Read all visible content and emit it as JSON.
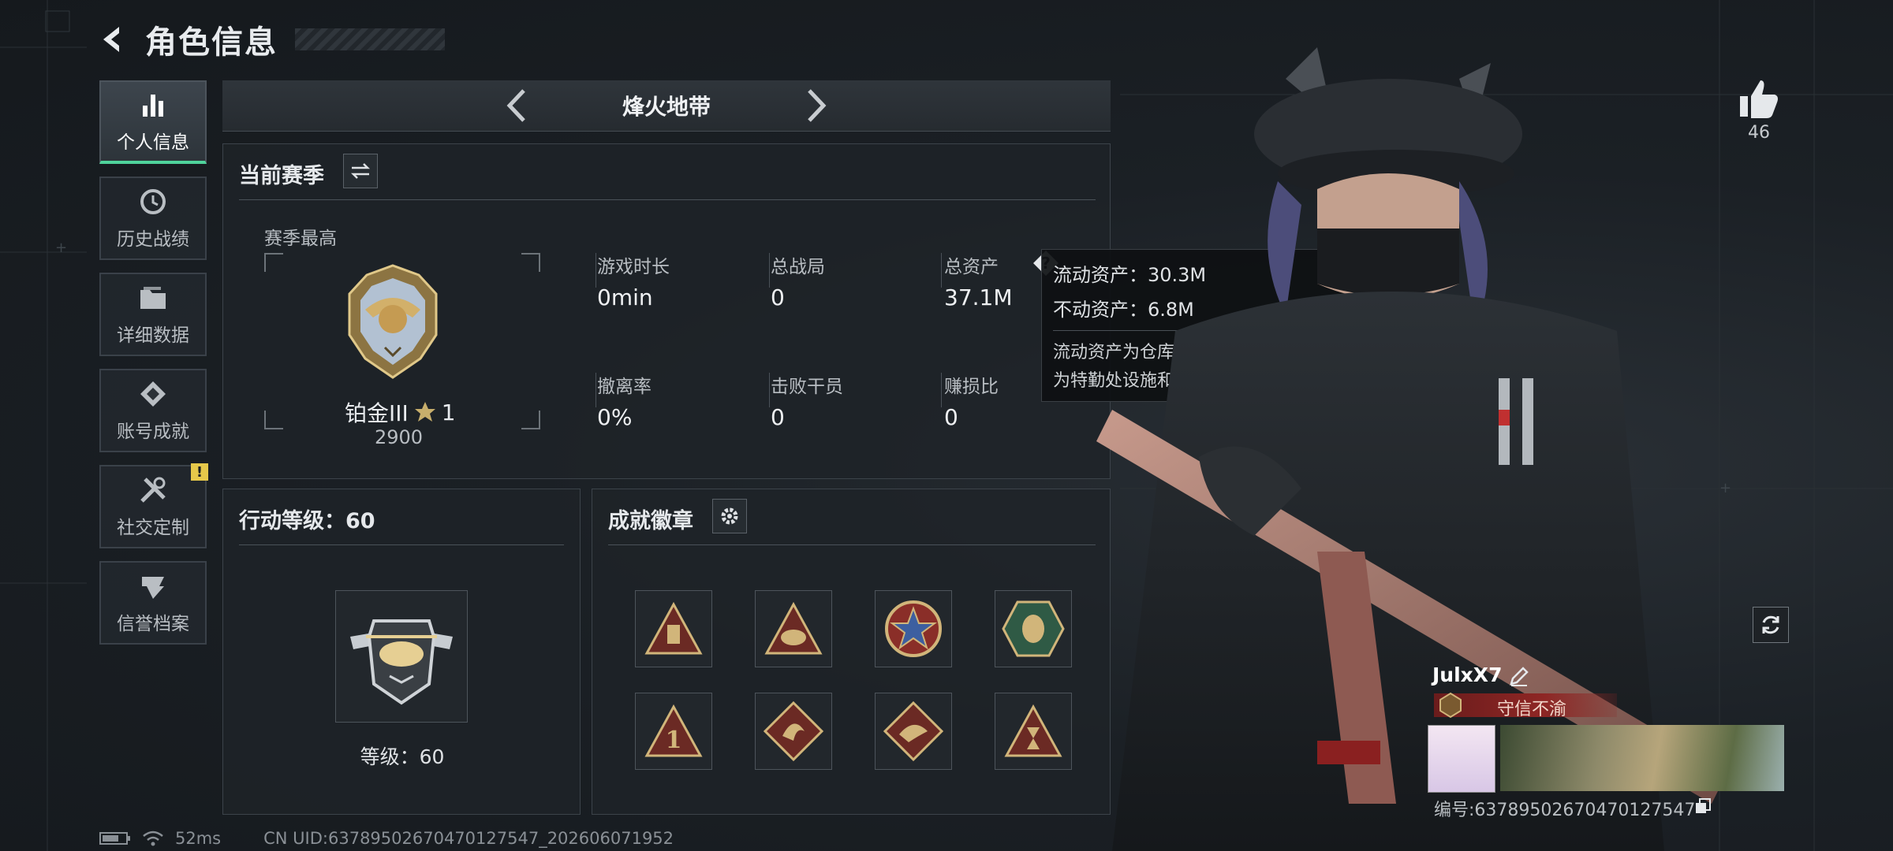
{
  "header": {
    "title": "角色信息"
  },
  "sidebar": {
    "items": [
      {
        "label": "个人信息",
        "icon": "bar-chart-icon"
      },
      {
        "label": "历史战绩",
        "icon": "history-icon"
      },
      {
        "label": "详细数据",
        "icon": "folder-icon"
      },
      {
        "label": "账号成就",
        "icon": "achievement-icon"
      },
      {
        "label": "社交定制",
        "icon": "tools-icon",
        "badge": "!"
      },
      {
        "label": "信誉档案",
        "icon": "credit-icon"
      }
    ]
  },
  "mode_bar": {
    "mode_name": "烽火地带"
  },
  "season": {
    "title": "当前赛季",
    "best_label": "赛季最高",
    "rank_name": "铂金III",
    "rank_stars": "1",
    "rank_score": "2900",
    "stats": [
      {
        "label": "游戏时长",
        "value": "0min"
      },
      {
        "label": "总战局",
        "value": "0"
      },
      {
        "label": "总资产",
        "value": "37.1M"
      },
      {
        "label": "撤离率",
        "value": "0%"
      },
      {
        "label": "击败干员",
        "value": "0"
      },
      {
        "label": "赚损比",
        "value": "0"
      }
    ]
  },
  "tooltip": {
    "liquid": "流动资产：30.3M",
    "fixed": "不动资产：6.8M",
    "desc1": "流动资产为仓库资产和哈夫币，不动资产",
    "desc2": "为特勤处设施和收藏室设施"
  },
  "action_level": {
    "title": "行动等级：60",
    "level_text": "等级：60"
  },
  "achievements": {
    "title": "成就徽章"
  },
  "player": {
    "name": "JulxX7",
    "title": "守信不渝",
    "uid_line": "编号:6378950267047012754​7",
    "likes": "46"
  },
  "status": {
    "ping": "52ms",
    "uid": "CN UID:6378950267047012754​7_202606071952"
  },
  "colors": {
    "accent_green": "#4fd39b",
    "warning_yellow": "#e6c84a",
    "title_red": "#8e2624"
  }
}
